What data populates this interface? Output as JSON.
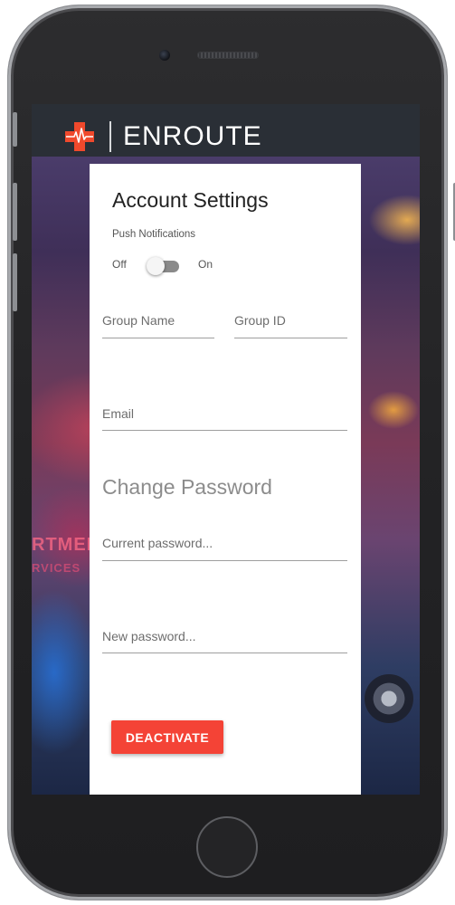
{
  "header": {
    "brand": "ENROUTE",
    "logo_icon": "medical-cross-heartbeat-icon"
  },
  "settings": {
    "title": "Account Settings",
    "push_notifications": {
      "label": "Push Notifications",
      "off_label": "Off",
      "on_label": "On",
      "state": "off"
    },
    "fields": {
      "group_name": "Group Name",
      "group_id": "Group ID",
      "email": "Email"
    },
    "change_password": {
      "heading": "Change Password",
      "current_placeholder": "Current password...",
      "new_placeholder": "New password..."
    },
    "deactivate_label": "DEACTIVATE"
  },
  "colors": {
    "accent": "#f44336",
    "topbar": "#2a2f36"
  }
}
